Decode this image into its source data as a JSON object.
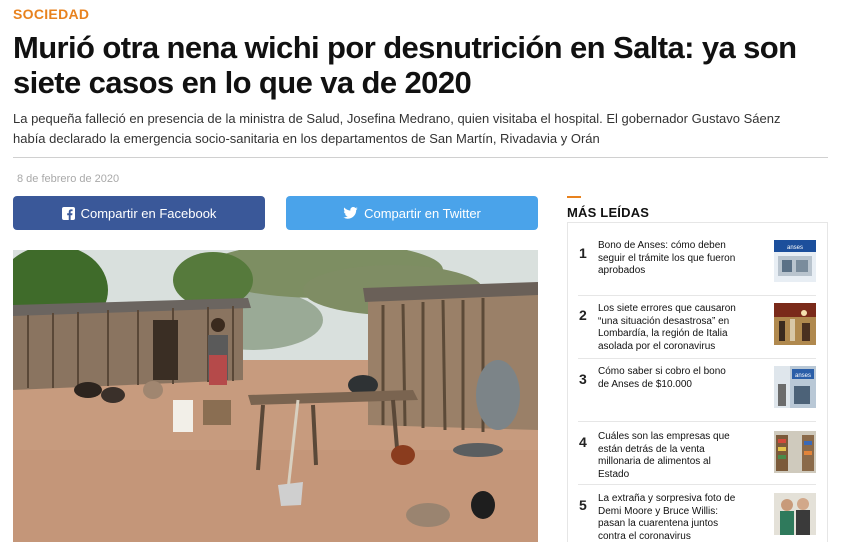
{
  "article": {
    "section": "SOCIEDAD",
    "headline": "Murió otra nena wichi por desnutrición en Salta: ya son siete casos en lo que va de 2020",
    "summary": "La pequeña falleció en presencia de la ministra de Salud, Josefina Medrano, quien visitaba el hospital. El gobernador Gustavo Sáenz había declarado la emergencia socio-sanitaria en los departamentos de San Martín, Rivadavia y Orán",
    "date": "8 de febrero de 2020"
  },
  "share": {
    "facebook_label": "Compartir en Facebook",
    "twitter_label": "Compartir en Twitter",
    "facebook_color": "#3a5899",
    "twitter_color": "#4aa3ea"
  },
  "sidebar": {
    "title": "MÁS LEÍDAS",
    "accent": "#e8821e",
    "items": [
      {
        "num": "1",
        "title": "Bono de Anses: cómo deben seguir el trámite los que fueron aprobados"
      },
      {
        "num": "2",
        "title": "Los siete errores que causaron “una situación desastrosa” en Lombardía, la región de Italia asolada por el coronavirus"
      },
      {
        "num": "3",
        "title": "Cómo saber si cobro el bono de Anses de $10.000"
      },
      {
        "num": "4",
        "title": "Cuáles son las empresas que están detrás de la venta millonaria de alimentos al Estado"
      },
      {
        "num": "5",
        "title": "La extraña y sorpresiva foto de Demi Moore y Bruce Willis: pasan la cuarentena juntos contra el coronavirus"
      }
    ]
  }
}
